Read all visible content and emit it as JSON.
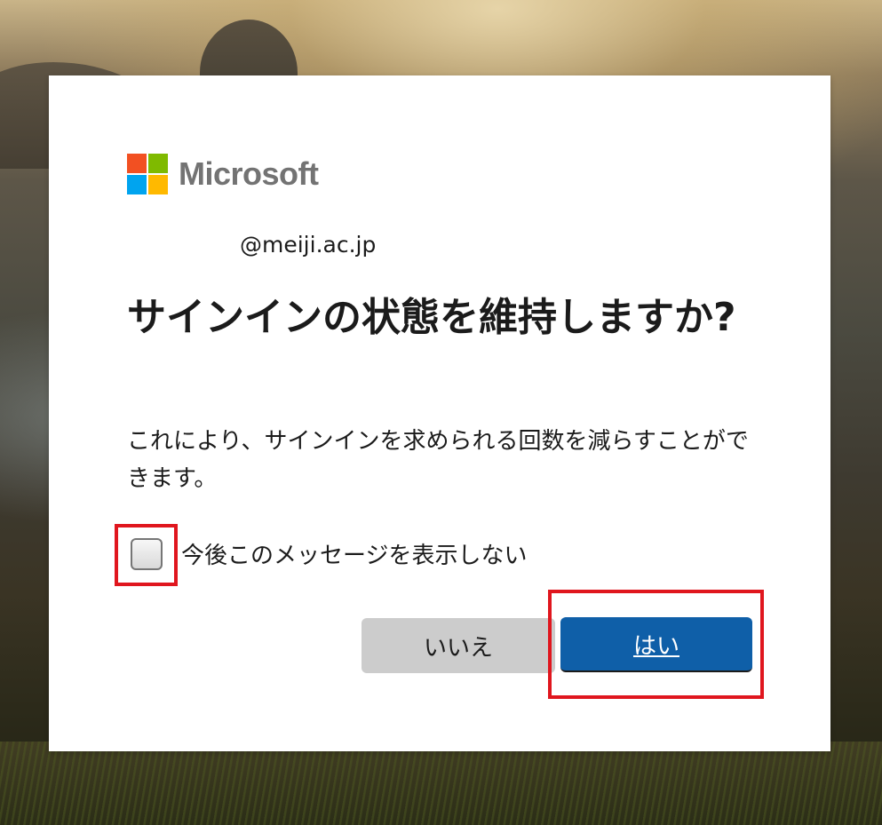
{
  "brand": {
    "logo_text": "Microsoft",
    "logo_colors": [
      "#f25022",
      "#7fba00",
      "#00a4ef",
      "#ffb900"
    ]
  },
  "account": {
    "email_text": "@meiji.ac.jp"
  },
  "dialog": {
    "title": "サインインの状態を維持しますか?",
    "description": "これにより、サインインを求められる回数を減らすことができます。",
    "checkbox_label": "今後このメッセージを表示しない",
    "checkbox_checked": false,
    "no_button_label": "いいえ",
    "yes_button_label": "はい"
  },
  "colors": {
    "primary_button": "#0f5fa8",
    "secondary_button": "#cccccc",
    "highlight": "#e0161e"
  }
}
